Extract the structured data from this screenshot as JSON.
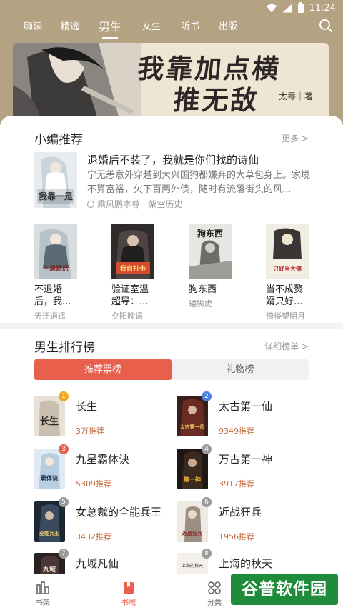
{
  "status": {
    "time": "11:24"
  },
  "nav_tabs": [
    {
      "label": "嗨读"
    },
    {
      "label": "精选"
    },
    {
      "label": "男生"
    },
    {
      "label": "女生"
    },
    {
      "label": "听书"
    },
    {
      "label": "出版"
    }
  ],
  "banner": {
    "title_line1": "我靠加点横",
    "title_line2": "推无敌",
    "author": "太零｜著"
  },
  "recommend": {
    "title": "小编推荐",
    "more": "更多 >",
    "featured": {
      "cover_text": "我靠一是",
      "title": "退婚后不装了，我就是你们找的诗仙",
      "description": "宁无恙意外穿越到大兴国狗都嫌弃的大草包身上。家境不算富裕，欠下百两外债，随时有流落街头的风...",
      "meta": "乘风鹏本尊 · 架空历史"
    },
    "books": [
      {
        "title": "不退婚后，我...",
        "author": "天迁逍遥",
        "cover_text": "不退婚后"
      },
      {
        "title": "验证室温超导：...",
        "author": "夕阳晚谣",
        "cover_text": "我自打卡"
      },
      {
        "title": "狗东西",
        "author": "矮脚虎",
        "cover_text": "狗东西"
      },
      {
        "title": "当不成赘婿只好...",
        "author": "倚楼望明月",
        "cover_text": "只好当大儒"
      }
    ]
  },
  "ranking": {
    "title": "男生排行榜",
    "more": "详细榜单 >",
    "toggle_active": "推荐票榜",
    "toggle_inactive": "礼物榜",
    "items": [
      {
        "rank": "1",
        "name": "长生",
        "votes": "3万推荐",
        "badge_color": "#f5a623",
        "cover_text": "长生"
      },
      {
        "rank": "2",
        "name": "太古第一仙",
        "votes": "9349推荐",
        "badge_color": "#4a7fe0",
        "cover_text": "太古第一仙"
      },
      {
        "rank": "3",
        "name": "九星霸体诀",
        "votes": "5309推荐",
        "badge_color": "#e8604b",
        "cover_text": "霸体诀"
      },
      {
        "rank": "4",
        "name": "万古第一神",
        "votes": "3917推荐",
        "badge_color": "#9b9b9b",
        "cover_text": "第一神"
      },
      {
        "rank": "5",
        "name": "女总裁的全能兵王",
        "votes": "3432推荐",
        "badge_color": "#9b9b9b",
        "cover_text": "全能兵王"
      },
      {
        "rank": "6",
        "name": "近战狂兵",
        "votes": "1956推荐",
        "badge_color": "#9b9b9b",
        "cover_text": "近战狂兵"
      },
      {
        "rank": "7",
        "name": "九域凡仙",
        "votes": "",
        "badge_color": "#9b9b9b",
        "cover_text": "九域"
      },
      {
        "rank": "8",
        "name": "上海的秋天",
        "votes": "",
        "badge_color": "#9b9b9b",
        "cover_text": "上海的秋天"
      }
    ]
  },
  "bottom_nav": [
    {
      "label": "书架"
    },
    {
      "label": "书城"
    },
    {
      "label": "分类"
    }
  ],
  "watermark": "谷普软件园"
}
